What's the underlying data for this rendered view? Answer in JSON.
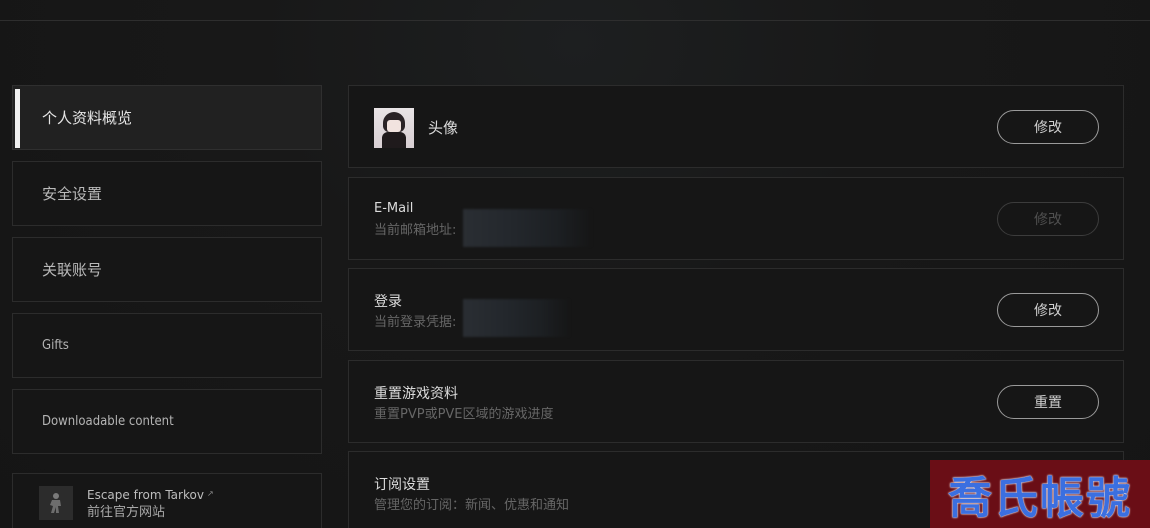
{
  "sidebar": {
    "items": [
      {
        "label": "个人资料概览"
      },
      {
        "label": "安全设置"
      },
      {
        "label": "关联账号"
      },
      {
        "label": "Gifts"
      },
      {
        "label": "Downloadable content"
      }
    ],
    "game": {
      "title": "Escape from Tarkov",
      "subtitle": "前往官方网站",
      "icon": "soldier-icon",
      "external_icon": "external-link-icon"
    }
  },
  "main": {
    "avatar_panel": {
      "title": "头像",
      "button": "修改"
    },
    "email_panel": {
      "title": "E-Mail",
      "subtitle": "当前邮箱地址:",
      "button": "修改",
      "button_disabled": true
    },
    "login_panel": {
      "title": "登录",
      "subtitle": "当前登录凭据:",
      "button": "修改"
    },
    "reset_panel": {
      "title": "重置游戏资料",
      "subtitle": "重置PVP或PVE区域的游戏进度",
      "button": "重置"
    },
    "subscription_panel": {
      "title": "订阅设置",
      "subtitle": "管理您的订阅：新闻、优惠和通知"
    }
  },
  "watermark": {
    "text": "喬氏帳號",
    "color": "#3b6fe0",
    "background": "#6a0e16"
  },
  "colors": {
    "background": "#171717",
    "panel_border": "#2c2c2c",
    "active_bar": "#f0f0f0"
  }
}
